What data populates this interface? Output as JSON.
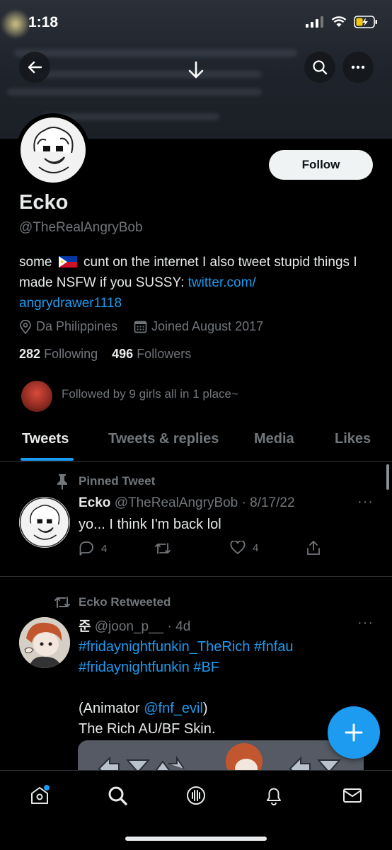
{
  "status_bar": {
    "time": "1:18"
  },
  "profile": {
    "name": "Ecko",
    "handle": "@TheRealAngryBob",
    "follow_label": "Follow",
    "bio_part1": "some",
    "bio_part2": "cunt on the internet I also tweet stupid things I made NSFW if you SUSSY:",
    "bio_link_line1": "twitter.com/",
    "bio_link_line2": "angrydrawer1118",
    "location": "Da Philippines",
    "joined": "Joined August 2017",
    "following_count": "282",
    "following_label": "Following",
    "followers_count": "496",
    "followers_label": "Followers",
    "followed_by": "Followed by 9 girls all in 1 place~"
  },
  "tabs": [
    {
      "label": "Tweets"
    },
    {
      "label": "Tweets & replies"
    },
    {
      "label": "Media"
    },
    {
      "label": "Likes"
    }
  ],
  "tweets": [
    {
      "context": "Pinned Tweet",
      "name": "Ecko",
      "meta": "@TheRealAngryBob · 8/17/22",
      "text": "yo... I think I'm back lol",
      "reply_count": "4",
      "like_count": "4"
    },
    {
      "context": "Ecko Retweeted",
      "name": "준",
      "meta": "@joon_p__ · 4d",
      "hashtags_line1": "#fridaynightfunkin_TheRich #fnfau",
      "hashtags_line2": "#fridaynightfunkin #BF",
      "animator_prefix": "(Animator ",
      "animator_handle": "@fnf_evil",
      "animator_suffix": ")",
      "line_last": "The Rich AU/BF Skin."
    }
  ],
  "colors": {
    "accent": "#1d9bf0",
    "background": "#000000",
    "muted": "#71767b"
  },
  "icons": [
    "back-arrow-icon",
    "down-arrow-icon",
    "search-icon",
    "more-icon",
    "location-icon",
    "calendar-icon",
    "pin-icon",
    "retweet-icon",
    "reply-icon",
    "like-icon",
    "share-icon",
    "compose-icon",
    "home-icon",
    "spaces-icon",
    "notifications-icon",
    "messages-icon"
  ]
}
